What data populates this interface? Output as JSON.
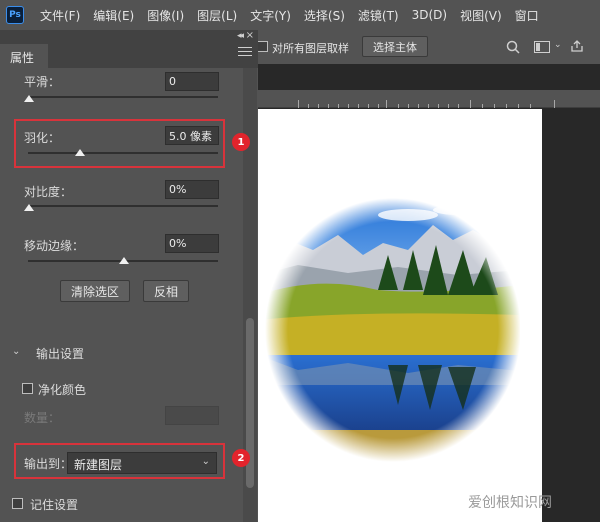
{
  "app": {
    "logo": "Ps"
  },
  "menubar": {
    "items": [
      "文件(F)",
      "编辑(E)",
      "图像(I)",
      "图层(L)",
      "文字(Y)",
      "选择(S)",
      "滤镜(T)",
      "3D(D)",
      "视图(V)",
      "窗口"
    ]
  },
  "panel": {
    "tab": "属性",
    "smooth": {
      "label": "平滑：",
      "value": "0",
      "slider_fraction": 0.0
    },
    "feather": {
      "label": "羽化：",
      "value": "5.0 像素",
      "slider_fraction": 0.28
    },
    "contrast": {
      "label": "对比度：",
      "value": "0%",
      "slider_fraction": 0.0
    },
    "shift_edge": {
      "label": "移动边缘：",
      "value": "0%",
      "slider_fraction": 0.5
    },
    "clear_selection_button": "清除选区",
    "invert_button": "反相",
    "output_settings": {
      "label": "输出设置"
    },
    "decontaminate": {
      "label": "净化颜色"
    },
    "amount": {
      "label": "数量："
    },
    "output_to": {
      "label": "输出到：",
      "value": "新建图层"
    },
    "remember": {
      "label": "记住设置"
    }
  },
  "options_bar": {
    "sample_all_layers": "对所有图层取样",
    "select_subject_button": "选择主体"
  },
  "annotations": {
    "badge1": "1",
    "badge2": "2",
    "accent": "#d8333b"
  },
  "watermark": "爱创根知识网"
}
